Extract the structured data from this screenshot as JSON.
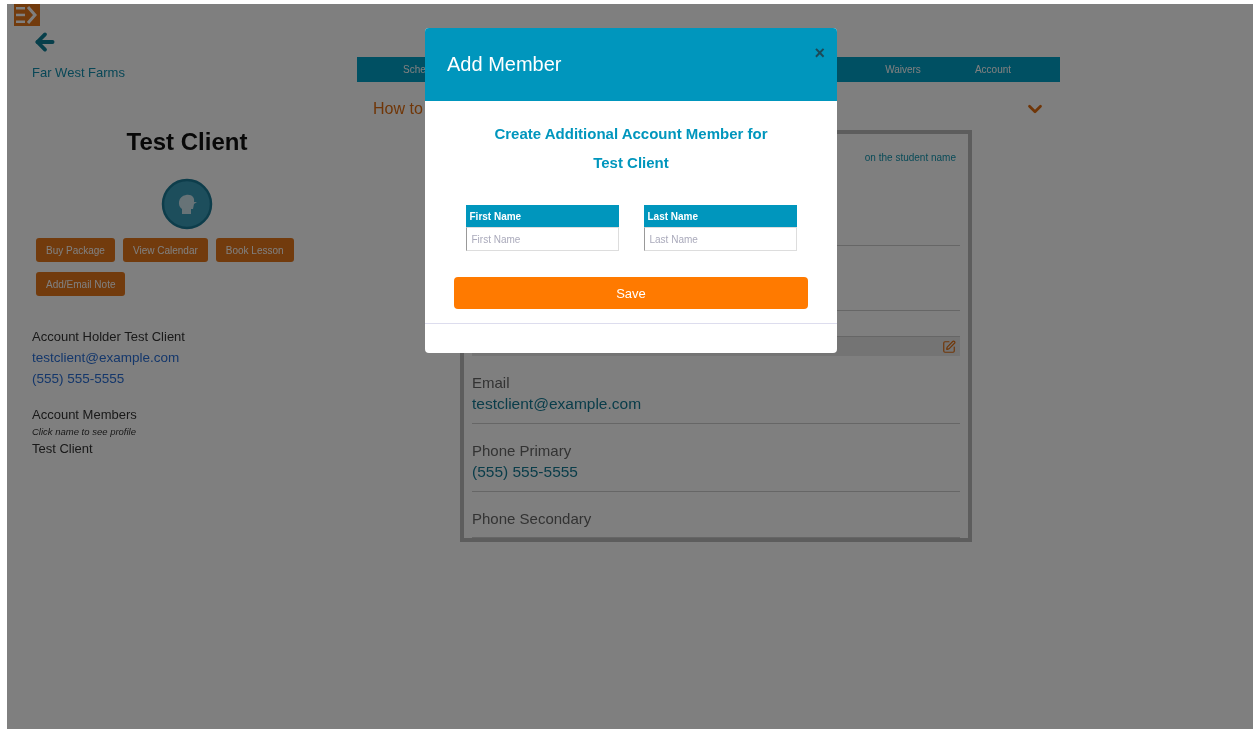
{
  "sidebar": {
    "brand": "Far West Farms",
    "client_name": "Test Client",
    "actions": [
      "Buy Package",
      "View Calendar",
      "Book Lesson",
      "Add/Email Note"
    ],
    "holder": {
      "label": "Account Holder Test Client",
      "email": "testclient@example.com",
      "phone": "(555) 555-5555"
    },
    "members": {
      "title": "Account Members",
      "hint": "Click name to see profile",
      "items": [
        "Test Client"
      ]
    }
  },
  "nav": {
    "left_items": [
      "Sche"
    ],
    "right_items": [
      "Waivers",
      "Account"
    ]
  },
  "help": {
    "title": "How to"
  },
  "profile": {
    "note": "on the student name",
    "fields": [
      {
        "label": "Email",
        "value": "testclient@example.com"
      },
      {
        "label": "Phone Primary",
        "value": "(555) 555-5555"
      },
      {
        "label": "Phone Secondary"
      }
    ]
  },
  "modal": {
    "title": "Add Member",
    "close": "×",
    "heading": "Create Additional Account Member for",
    "client_name": "Test Client",
    "fields": [
      {
        "label": "First Name",
        "placeholder": "First Name"
      },
      {
        "label": "Last Name",
        "placeholder": "Last Name"
      }
    ],
    "save": "Save"
  }
}
